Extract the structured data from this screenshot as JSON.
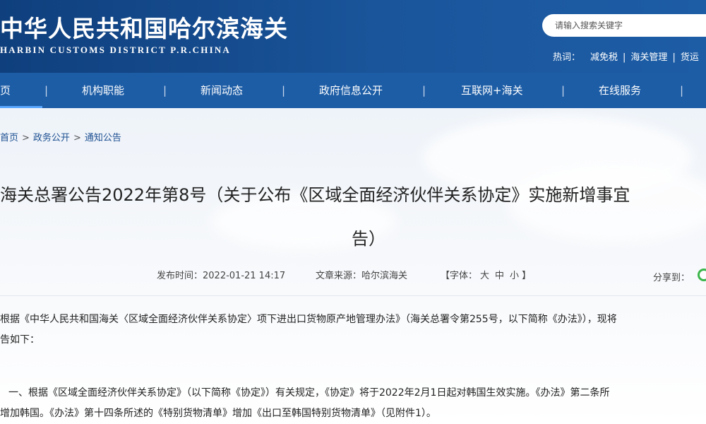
{
  "header": {
    "title": "中华人民共和国哈尔滨海关",
    "subtitle": "HARBIN CUSTOMS DISTRICT P.R.CHINA",
    "search_placeholder": "请输入搜索关键字",
    "hot_label": "热词：",
    "hot_items": [
      "减免税",
      "海关管理",
      "货运"
    ]
  },
  "nav": {
    "items": [
      "页",
      "机构职能",
      "新闻动态",
      "政府信息公开",
      "互联网+海关",
      "在线服务"
    ],
    "separator": "|"
  },
  "breadcrumb": {
    "items": [
      "首页",
      "政务公开",
      "通知公告"
    ],
    "separator": ">"
  },
  "article": {
    "title_line1": "海关总署公告2022年第8号（关于公布《区域全面经济伙伴关系协定》实施新增事宜",
    "title_line2": "告）",
    "publish_time": "发布时间：2022-01-21 14:17",
    "source": "文章来源：哈尔滨海关",
    "font_label": "【字体：",
    "font_sizes": [
      "大",
      "中",
      "小"
    ],
    "font_end": "】",
    "share_label": "分享到：",
    "paragraph1_line1": "根据《中华人民共和国海关〈区域全面经济伙伴关系协定〉项下进出口货物原产地管理办法》（海关总署令第255号，以下简称《办法》），现将",
    "paragraph1_line2": "告如下：",
    "paragraph2_line1": "一、根据《区域全面经济伙伴关系协定》（以下简称《协定》）有关规定，《协定》将于2022年2月1日起对韩国生效实施。《办法》第二条所",
    "paragraph2_line2": "增加韩国。《办法》第十四条所述的《特别货物清单》增加《出口至韩国特别货物清单》（见附件1）。"
  },
  "colors": {
    "header_bg": "#1a559b",
    "nav_bg": "#1d5da6",
    "link": "#1d4f91",
    "share_icon": "#3bb54a"
  }
}
